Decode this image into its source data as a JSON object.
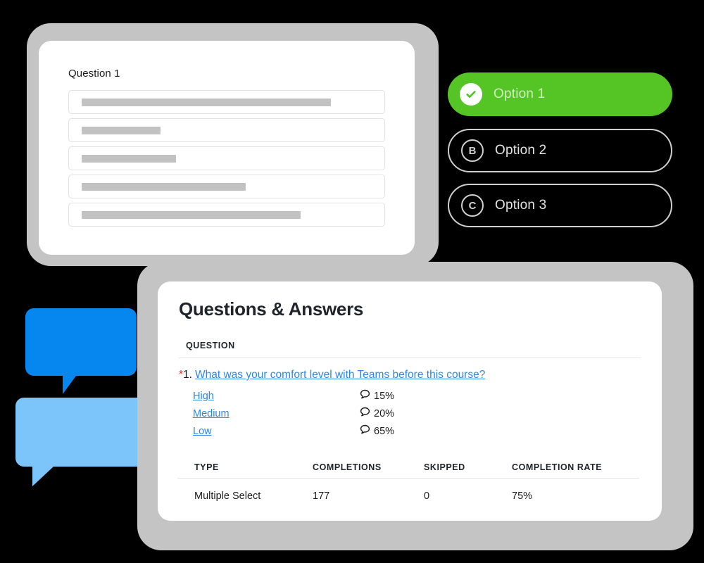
{
  "survey_card": {
    "question_title": "Question 1",
    "skeleton_fields": [
      {
        "bar_width_pct": 82
      },
      {
        "bar_width_pct": 26
      },
      {
        "bar_width_pct": 31
      },
      {
        "bar_width_pct": 54
      },
      {
        "bar_width_pct": 72
      }
    ]
  },
  "options": {
    "selected_index": 0,
    "items": [
      {
        "badge": "check-icon",
        "label": "Option 1",
        "state": "selected",
        "color": "#55c425"
      },
      {
        "badge": "B",
        "label": "Option 2",
        "state": "unselected",
        "color": "#cfcfcf"
      },
      {
        "badge": "C",
        "label": "Option 3",
        "state": "unselected",
        "color": "#cfcfcf"
      }
    ]
  },
  "speech_bubbles": [
    {
      "name": "bubble-dark",
      "color": "#0687f0"
    },
    {
      "name": "bubble-light",
      "color": "#7bc5fb"
    }
  ],
  "results_card": {
    "title": "Questions & Answers",
    "question_column_header": "QUESTION",
    "question": {
      "required_marker": "*",
      "number": "1.",
      "text": "What was your comfort level with Teams before this course?"
    },
    "answers": [
      {
        "label": "High",
        "percent": "15%",
        "icon": "comment-icon"
      },
      {
        "label": "Medium",
        "percent": "20%",
        "icon": "comment-icon"
      },
      {
        "label": "Low",
        "percent": "65%",
        "icon": "comment-icon"
      }
    ],
    "stats_table": {
      "headers": [
        "TYPE",
        "COMPLETIONS",
        "SKIPPED",
        "COMPLETION RATE"
      ],
      "rows": [
        [
          "Multiple Select",
          "177",
          "0",
          "75%"
        ]
      ]
    }
  },
  "theme": {
    "background": "#000000",
    "frame_gray": "#c4c4c4",
    "card_white": "#ffffff",
    "link_blue": "#2c86e8",
    "accent_green": "#55c425",
    "required_red": "#e02020"
  }
}
